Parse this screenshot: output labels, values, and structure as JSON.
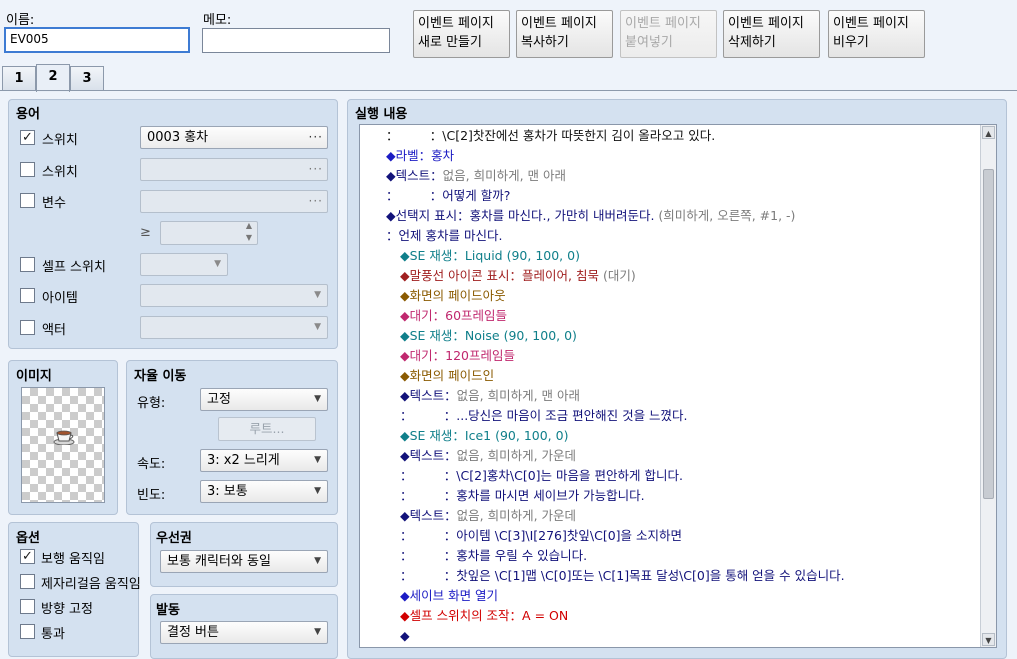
{
  "header": {
    "name_label": "이름:",
    "name_value": "EV005",
    "memo_label": "메모:",
    "memo_value": "",
    "buttons": [
      {
        "label": "이벤트 페이지\n새로 만들기",
        "enabled": true
      },
      {
        "label": "이벤트 페이지\n복사하기",
        "enabled": true
      },
      {
        "label": "이벤트 페이지\n붙여넣기",
        "enabled": false
      },
      {
        "label": "이벤트 페이지\n삭제하기",
        "enabled": true
      },
      {
        "label": "이벤트 페이지\n비우기",
        "enabled": true
      }
    ]
  },
  "tabs": [
    {
      "label": "1",
      "active": false
    },
    {
      "label": "2",
      "active": true
    },
    {
      "label": "3",
      "active": false
    }
  ],
  "conditions": {
    "title": "용어",
    "switch1": {
      "label": "스위치",
      "checked": true,
      "value": "0003 홍차"
    },
    "switch2": {
      "label": "스위치",
      "checked": false,
      "value": ""
    },
    "variable": {
      "label": "변수",
      "checked": false,
      "value": ""
    },
    "compare_symbol": "≥",
    "self_switch": {
      "label": "셀프 스위치",
      "checked": false
    },
    "item": {
      "label": "아이템",
      "checked": false
    },
    "actor": {
      "label": "액터",
      "checked": false
    }
  },
  "image": {
    "title": "이미지",
    "icon": "teacup-icon"
  },
  "autonomous": {
    "title": "자율 이동",
    "type_label": "유형:",
    "type_value": "고정",
    "route_button": "루트...",
    "speed_label": "속도:",
    "speed_value": "3: x2 느리게",
    "freq_label": "빈도:",
    "freq_value": "3: 보통"
  },
  "options": {
    "title": "옵션",
    "items": [
      {
        "label": "보행 움직임",
        "checked": true
      },
      {
        "label": "제자리걸음 움직임",
        "checked": false
      },
      {
        "label": "방향 고정",
        "checked": false
      },
      {
        "label": "통과",
        "checked": false
      }
    ]
  },
  "priority": {
    "title": "우선권",
    "value": "보통 캐릭터와 동일"
  },
  "trigger": {
    "title": "발동",
    "value": "결정 버튼"
  },
  "commands": {
    "title": "실행 내용",
    "lines": [
      {
        "indent": 0,
        "parts": [
          {
            "t": "：　　　：\\C[2]찻잔에선 홍차가 따뜻한지 김이 올라오고 있다.",
            "c": "black"
          }
        ]
      },
      {
        "indent": 0,
        "parts": [
          {
            "t": "◆라벨：홍차",
            "c": "blue"
          }
        ]
      },
      {
        "indent": 0,
        "parts": [
          {
            "t": "◆텍스트：",
            "c": "navy"
          },
          {
            "t": "없음, 희미하게, 맨 아래",
            "c": "gray"
          }
        ]
      },
      {
        "indent": 0,
        "parts": [
          {
            "t": "：　　　：어떻게 할까?",
            "c": "navy"
          }
        ]
      },
      {
        "indent": 0,
        "parts": [
          {
            "t": "◆선택지 표시：홍차를 마신다., 가만히 내버려둔다. ",
            "c": "navy"
          },
          {
            "t": "(희미하게, 오른쪽, #1, -)",
            "c": "gray"
          }
        ]
      },
      {
        "indent": 0,
        "parts": [
          {
            "t": "：언제 홍차를 마신다.",
            "c": "navy"
          }
        ]
      },
      {
        "indent": 1,
        "parts": [
          {
            "t": "◆SE 재생：Liquid (90, 100, 0)",
            "c": "teal"
          }
        ]
      },
      {
        "indent": 1,
        "parts": [
          {
            "t": "◆말풍선 아이콘 표시：플레이어, 침묵 ",
            "c": "brown"
          },
          {
            "t": "(대기)",
            "c": "gray"
          }
        ]
      },
      {
        "indent": 1,
        "parts": [
          {
            "t": "◆화면의 페이드아웃",
            "c": "olive"
          }
        ]
      },
      {
        "indent": 1,
        "parts": [
          {
            "t": "◆대기：60프레임들",
            "c": "pink"
          }
        ]
      },
      {
        "indent": 1,
        "parts": [
          {
            "t": "◆SE 재생：Noise (90, 100, 0)",
            "c": "teal"
          }
        ]
      },
      {
        "indent": 1,
        "parts": [
          {
            "t": "◆대기：120프레임들",
            "c": "pink"
          }
        ]
      },
      {
        "indent": 1,
        "parts": [
          {
            "t": "◆화면의 페이드인",
            "c": "olive"
          }
        ]
      },
      {
        "indent": 1,
        "parts": [
          {
            "t": "◆텍스트：",
            "c": "navy"
          },
          {
            "t": "없음, 희미하게, 맨 아래",
            "c": "gray"
          }
        ]
      },
      {
        "indent": 1,
        "parts": [
          {
            "t": "：　　　：...당신은 마음이 조금 편안해진 것을 느꼈다.",
            "c": "navy"
          }
        ]
      },
      {
        "indent": 1,
        "parts": [
          {
            "t": "◆SE 재생：Ice1 (90, 100, 0)",
            "c": "teal"
          }
        ]
      },
      {
        "indent": 1,
        "parts": [
          {
            "t": "◆텍스트：",
            "c": "navy"
          },
          {
            "t": "없음, 희미하게, 가운데",
            "c": "gray"
          }
        ]
      },
      {
        "indent": 1,
        "parts": [
          {
            "t": "：　　　：\\C[2]홍차\\C[0]는 마음을 편안하게 합니다.",
            "c": "navy"
          }
        ]
      },
      {
        "indent": 1,
        "parts": [
          {
            "t": "：　　　：홍차를 마시면 세이브가 가능합니다.",
            "c": "navy"
          }
        ]
      },
      {
        "indent": 1,
        "parts": [
          {
            "t": "◆텍스트：",
            "c": "navy"
          },
          {
            "t": "없음, 희미하게, 가운데",
            "c": "gray"
          }
        ]
      },
      {
        "indent": 1,
        "parts": [
          {
            "t": "：　　　：아이템 \\C[3]\\I[276]찻잎\\C[0]을 소지하면",
            "c": "navy"
          }
        ]
      },
      {
        "indent": 1,
        "parts": [
          {
            "t": "：　　　：홍차를 우릴 수 있습니다.",
            "c": "navy"
          }
        ]
      },
      {
        "indent": 1,
        "parts": [
          {
            "t": "：　　　：찻잎은 \\C[1]맵 \\C[0]또는 \\C[1]목표 달성\\C[0]을 통해 얻을 수 있습니다.",
            "c": "navy"
          }
        ]
      },
      {
        "indent": 1,
        "parts": [
          {
            "t": "◆세이브 화면 열기",
            "c": "blue"
          }
        ]
      },
      {
        "indent": 1,
        "parts": [
          {
            "t": "◆셀프 스위치의 조작：A = ON",
            "c": "red"
          }
        ]
      },
      {
        "indent": 1,
        "parts": [
          {
            "t": "◆",
            "c": "navy"
          }
        ]
      }
    ]
  }
}
